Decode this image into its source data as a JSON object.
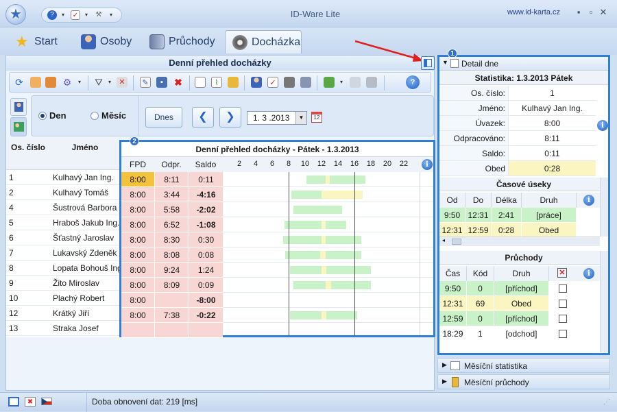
{
  "window": {
    "title": "ID-Ware Lite",
    "url": "www.id-karta.cz",
    "minimize": "▪",
    "restore": "▫",
    "close": "✕"
  },
  "tabs": [
    {
      "label": "Start"
    },
    {
      "label": "Osoby"
    },
    {
      "label": "Průchody"
    },
    {
      "label": "Docházka"
    }
  ],
  "left": {
    "header": "Denní přehled docházky",
    "filter": {
      "den_label": "Den",
      "mesic_label": "Měsíc",
      "today_button": "Dnes",
      "date_value": "1. 3 .2013",
      "prev": "❮",
      "next": "❯"
    },
    "names_table": {
      "headers": [
        "Os. číslo",
        "Jméno"
      ],
      "rows": [
        [
          "1",
          "Kulhavý Jan Ing."
        ],
        [
          "2",
          "Kulhavý Tomáš"
        ],
        [
          "4",
          "Šustrová Barbora"
        ],
        [
          "5",
          "Hraboš Jakub Ing."
        ],
        [
          "6",
          "Šťastný Jaroslav"
        ],
        [
          "7",
          "Lukavský Zdeněk"
        ],
        [
          "8",
          "Lopata Bohouš Ing."
        ],
        [
          "9",
          "Žito Miroslav"
        ],
        [
          "10",
          "Plachý Robert"
        ],
        [
          "12",
          "Krátký Jiří"
        ],
        [
          "13",
          "Straka Josef"
        ]
      ]
    }
  },
  "report": {
    "title": "Denní přehled docházky - Pátek - 1.3.2013",
    "headers": [
      "FPD",
      "Odpr.",
      "Saldo"
    ],
    "hour_ticks": [
      "2",
      "4",
      "6",
      "8",
      "10",
      "12",
      "14",
      "16",
      "18",
      "20",
      "22"
    ],
    "rows": [
      {
        "fpd": "8:00",
        "odpr": "8:11",
        "saldo": "0:11",
        "neg": false,
        "bars": [
          [
            10.2,
            12.5,
            "g"
          ],
          [
            12.5,
            13.0,
            "y"
          ],
          [
            13.0,
            17.3,
            "g"
          ]
        ]
      },
      {
        "fpd": "8:00",
        "odpr": "3:44",
        "saldo": "-4:16",
        "neg": true,
        "bars": [
          [
            8.3,
            12.0,
            "g"
          ],
          [
            12.0,
            17.0,
            "y"
          ]
        ]
      },
      {
        "fpd": "8:00",
        "odpr": "5:58",
        "saldo": "-2:02",
        "neg": true,
        "bars": [
          [
            8.6,
            14.5,
            "g"
          ]
        ]
      },
      {
        "fpd": "8:00",
        "odpr": "6:52",
        "saldo": "-1:08",
        "neg": true,
        "bars": [
          [
            7.5,
            12.0,
            "g"
          ],
          [
            12.0,
            12.5,
            "y"
          ],
          [
            12.5,
            15.0,
            "g"
          ]
        ]
      },
      {
        "fpd": "8:00",
        "odpr": "8:30",
        "saldo": "0:30",
        "neg": false,
        "bars": [
          [
            7.3,
            12.0,
            "g"
          ],
          [
            12.0,
            12.5,
            "y"
          ],
          [
            12.5,
            16.8,
            "g"
          ]
        ]
      },
      {
        "fpd": "8:00",
        "odpr": "8:08",
        "saldo": "0:08",
        "neg": false,
        "bars": [
          [
            7.6,
            11.8,
            "g"
          ],
          [
            11.8,
            12.5,
            "y"
          ],
          [
            12.5,
            16.8,
            "g"
          ]
        ]
      },
      {
        "fpd": "8:00",
        "odpr": "9:24",
        "saldo": "1:24",
        "neg": false,
        "bars": [
          [
            8.2,
            12.0,
            "g"
          ],
          [
            12.0,
            12.6,
            "y"
          ],
          [
            12.6,
            18.0,
            "g"
          ]
        ]
      },
      {
        "fpd": "8:00",
        "odpr": "8:09",
        "saldo": "0:09",
        "neg": false,
        "bars": [
          [
            8.6,
            12.5,
            "g"
          ],
          [
            12.5,
            13.2,
            "y"
          ],
          [
            13.2,
            18.0,
            "g"
          ]
        ]
      },
      {
        "fpd": "8:00",
        "odpr": "",
        "saldo": "-8:00",
        "neg": true,
        "bars": []
      },
      {
        "fpd": "8:00",
        "odpr": "7:38",
        "saldo": "-0:22",
        "neg": true,
        "bars": [
          [
            8.2,
            12.0,
            "g"
          ],
          [
            12.0,
            12.6,
            "y"
          ],
          [
            12.6,
            16.3,
            "g"
          ]
        ]
      },
      {
        "fpd": "",
        "odpr": "",
        "saldo": "",
        "neg": false,
        "bars": []
      }
    ],
    "markers": [
      8,
      16
    ]
  },
  "right": {
    "panel_title": "Detail dne",
    "stats_title": "Statistika: 1.3.2013 Pátek",
    "stats": [
      {
        "label": "Os. číslo:",
        "value": "1"
      },
      {
        "label": "Jméno:",
        "value": "Kulhavý Jan Ing."
      },
      {
        "label": "Úvazek:",
        "value": "8:00"
      },
      {
        "label": "Odpracováno:",
        "value": "8:11"
      },
      {
        "label": "Saldo:",
        "value": "0:11"
      },
      {
        "label": "Obed",
        "value": "0:28"
      }
    ],
    "segments": {
      "title": "Časové úseky",
      "headers": [
        "Od",
        "Do",
        "Délka",
        "Druh"
      ],
      "rows": [
        [
          "9:50",
          "12:31",
          "2:41",
          "[práce]"
        ],
        [
          "12:31",
          "12:59",
          "0:28",
          "Obed"
        ]
      ]
    },
    "passes": {
      "title": "Průchody",
      "headers": [
        "Čas",
        "Kód",
        "Druh"
      ],
      "rows": [
        [
          "9:50",
          "0",
          "[příchod]"
        ],
        [
          "12:31",
          "69",
          "Obed"
        ],
        [
          "12:59",
          "0",
          "[příchod]"
        ],
        [
          "18:29",
          "1",
          "[odchod]"
        ]
      ]
    },
    "monthly_stats": "Měsíční statistika",
    "monthly_passes": "Měsíční průchody"
  },
  "status": {
    "text": "Doba obnovení dat:  219 [ms]"
  },
  "callouts": [
    "1",
    "2"
  ],
  "colors": {
    "accent": "#2f7fd4",
    "green": "#c9f2c9",
    "yellow": "#fbf6c1",
    "pink": "#f8d6d4",
    "selected": "#f5c23d"
  }
}
